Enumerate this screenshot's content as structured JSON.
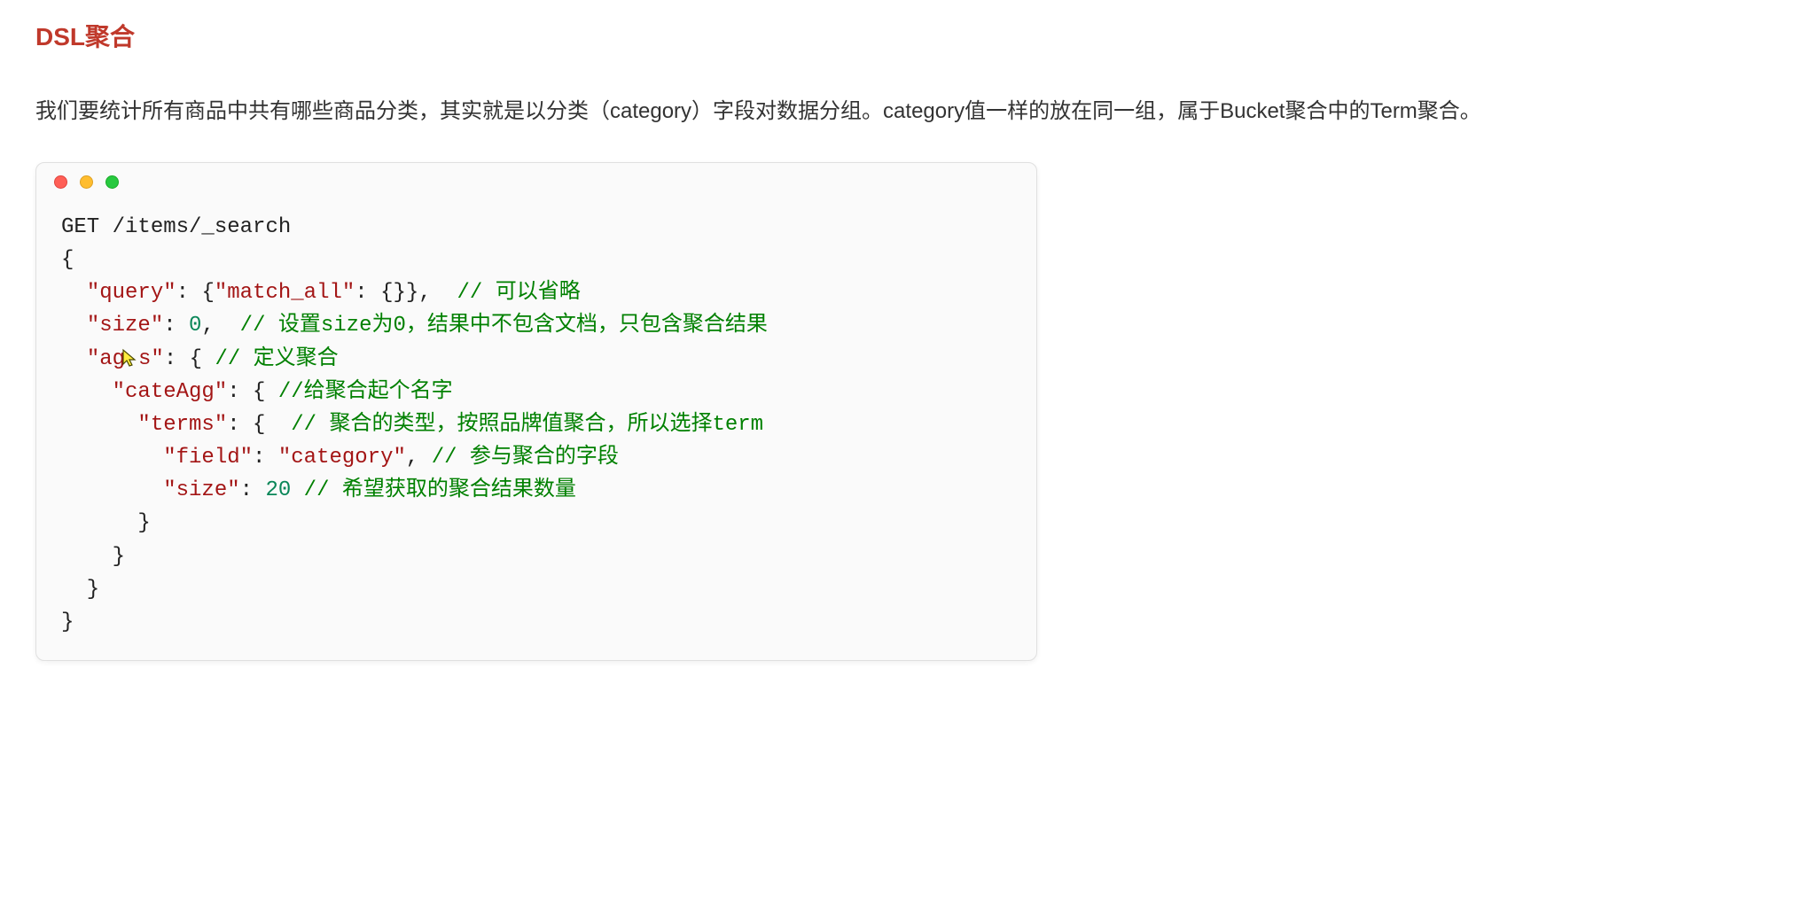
{
  "heading": "DSL聚合",
  "paragraph": "我们要统计所有商品中共有哪些商品分类，其实就是以分类（category）字段对数据分组。category值一样的放在同一组，属于Bucket聚合中的Term聚合。",
  "code": {
    "line1": "GET /items/_search",
    "line2": "{",
    "line3_key": "\"query\"",
    "line3_mid": ": {",
    "line3_key2": "\"match_all\"",
    "line3_end": ": {}},",
    "line3_cmt": "  // 可以省略",
    "line4_key": "\"size\"",
    "line4_mid": ": ",
    "line4_num": "0",
    "line4_end": ",",
    "line4_cmt": "  // 设置size为0，结果中不包含文档，只包含聚合结果",
    "line5_keyA": "\"ag",
    "line5_keyB": "s\"",
    "line5_mid": ": { ",
    "line5_cmt": "// 定义聚合",
    "line6_key": "\"cateAgg\"",
    "line6_mid": ": { ",
    "line6_cmt": "//给聚合起个名字",
    "line7_key": "\"terms\"",
    "line7_mid": ": { ",
    "line7_cmt": " // 聚合的类型，按照品牌值聚合，所以选择term",
    "line8_key": "\"field\"",
    "line8_mid": ": ",
    "line8_val": "\"category\"",
    "line8_end": ", ",
    "line8_cmt": "// 参与聚合的字段",
    "line9_key": "\"size\"",
    "line9_mid": ": ",
    "line9_num": "20",
    "line9_sp": " ",
    "line9_cmt": "// 希望获取的聚合结果数量",
    "line10": "      }",
    "line11": "    }",
    "line12": "  }",
    "line13": "}"
  }
}
